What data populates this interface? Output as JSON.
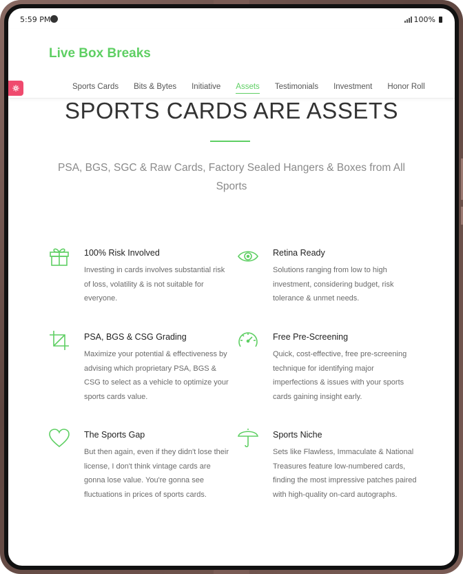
{
  "status_bar": {
    "time": "5:59 PM",
    "battery": "100%"
  },
  "header": {
    "logo": "Live Box Breaks",
    "nav": [
      "Sports Cards",
      "Bits & Bytes",
      "Initiative",
      "Assets",
      "Testimonials",
      "Investment",
      "Honor Roll"
    ],
    "active_nav": "Assets"
  },
  "hero": {
    "title": "SPORTS CARDS ARE ASSETS",
    "subtitle": "PSA, BGS, SGC & Raw Cards, Factory Sealed Hangers & Boxes from All Sports"
  },
  "features": [
    {
      "icon": "gift-icon",
      "title": "100% Risk Involved",
      "description": "Investing in cards involves substantial risk of loss, volatility & is not suitable for everyone."
    },
    {
      "icon": "eye-icon",
      "title": "Retina Ready",
      "description": "Solutions ranging from low to high investment, considering budget, risk tolerance & unmet needs."
    },
    {
      "icon": "crop-icon",
      "title": "PSA, BGS & CSG Grading",
      "description": "Maximize your potential & effectiveness by advising which proprietary PSA, BGS & CSG to select as a vehicle to optimize your sports cards value."
    },
    {
      "icon": "speedometer-icon",
      "title": "Free Pre-Screening",
      "description": "Quick, cost-effective, free pre-screening technique for identifying major imperfections & issues with your sports cards gaining insight early."
    },
    {
      "icon": "heart-icon",
      "title": "The Sports Gap",
      "description": "But then again, even if they didn't lose their license, I don't think vintage cards are gonna lose value. You're gonna see fluctuations in prices of sports cards."
    },
    {
      "icon": "umbrella-icon",
      "title": "Sports Niche",
      "description": "Sets like Flawless, Immaculate & National Treasures feature low-numbered cards, finding the most impressive patches paired with high-quality on-card autographs."
    }
  ],
  "colors": {
    "accent": "#5ecf63",
    "settings_button": "#ef4a6e",
    "frame": "#6b4f49"
  }
}
